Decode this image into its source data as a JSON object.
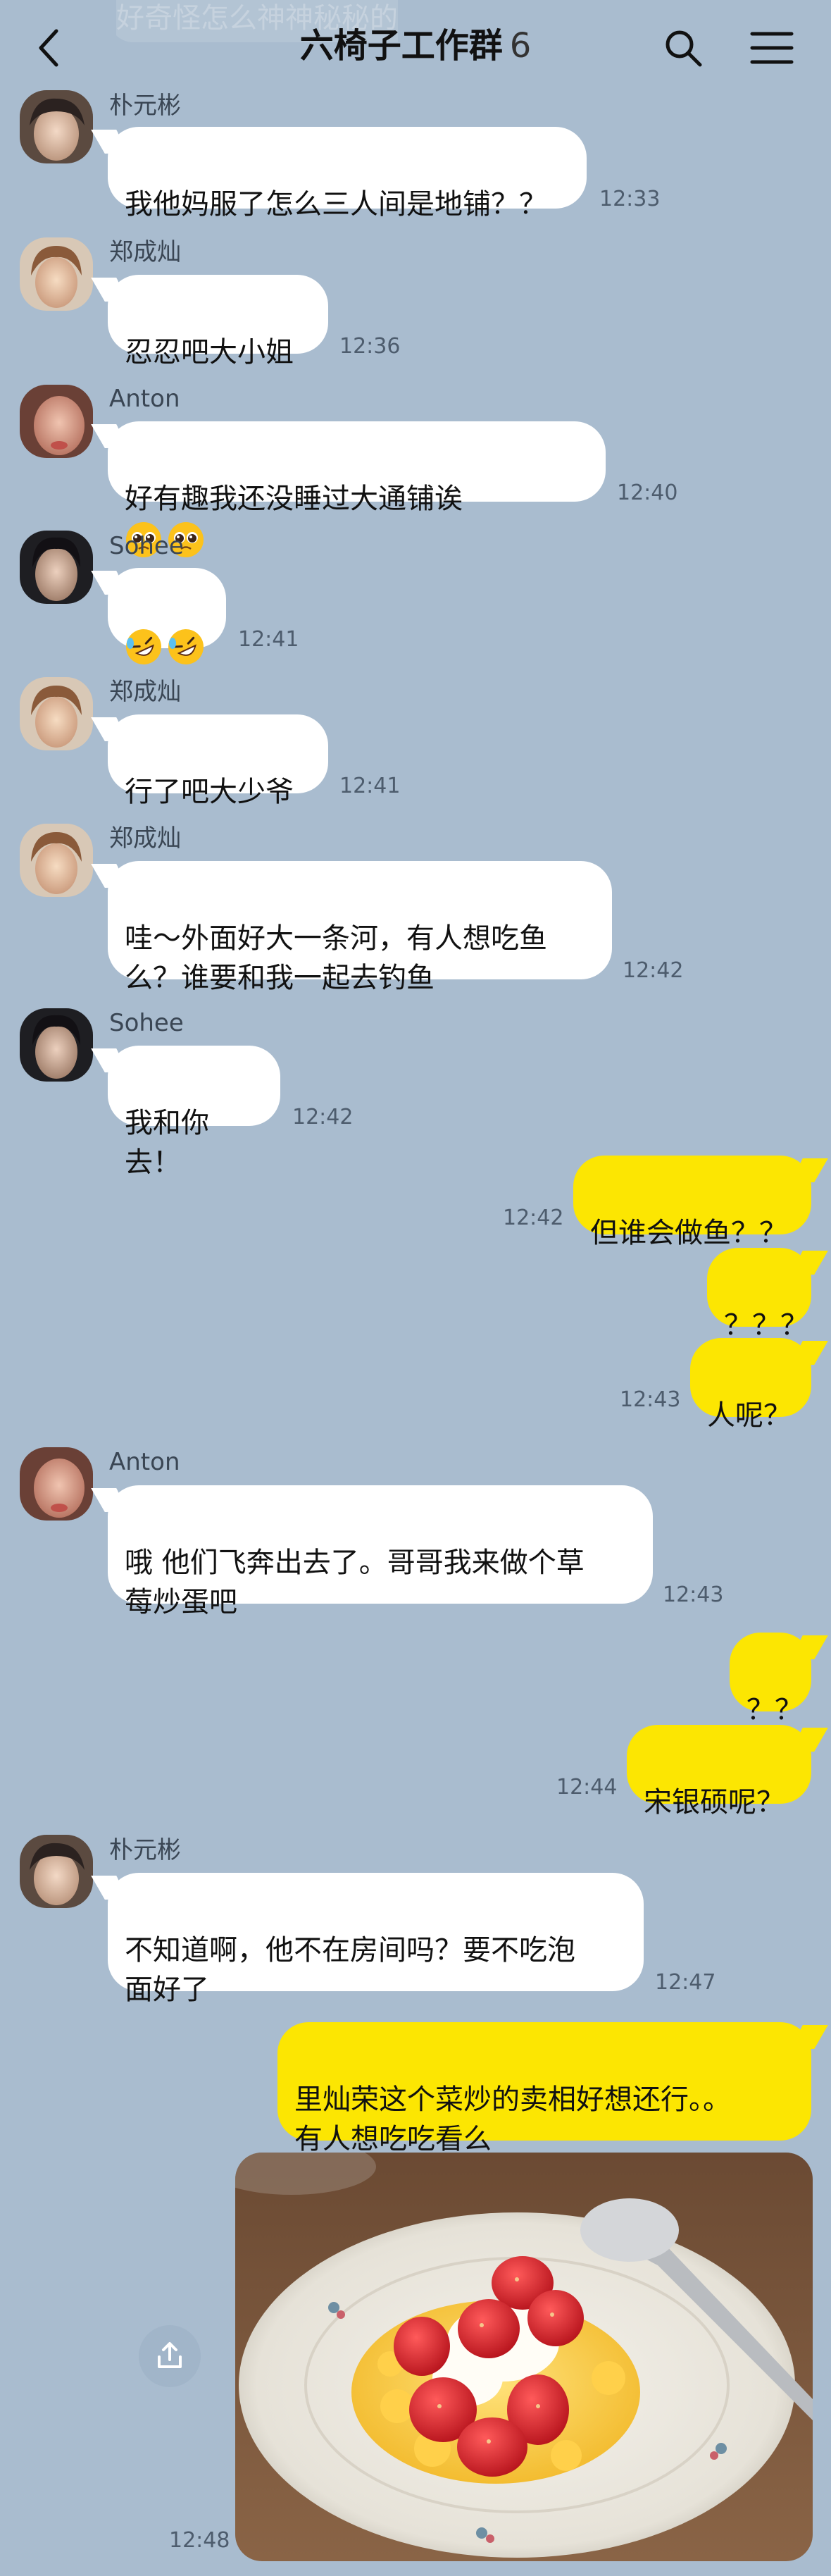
{
  "header": {
    "title": "六椅子工作群",
    "member_count": "6",
    "ghost_preview": "好奇怪怎么神神秘秘的"
  },
  "messages": [
    {
      "sender": "朴元彬",
      "text": "我他妈服了怎么三人间是地铺？？",
      "time": "12:33"
    },
    {
      "sender": "郑成灿",
      "text": "忍忍吧大小姐",
      "time": "12:36"
    },
    {
      "sender": "Anton",
      "text": "好有趣我还没睡过大通铺诶",
      "emojis": [
        "pleading-face",
        "pleading-face"
      ],
      "time": "12:40"
    },
    {
      "sender": "Sohee",
      "emojis": [
        "rolling-on-floor-laughing",
        "rolling-on-floor-laughing"
      ],
      "time": "12:41"
    },
    {
      "sender": "郑成灿",
      "text": "行了吧大少爷",
      "time": "12:41"
    },
    {
      "sender": "郑成灿",
      "text": "哇～外面好大一条河，有人想吃鱼\n么？谁要和我一起去钓鱼",
      "time": "12:42"
    },
    {
      "sender": "Sohee",
      "text": "我和你去！",
      "time": "12:42"
    },
    {
      "text": "但谁会做鱼？？",
      "time": "12:42"
    },
    {
      "text": "？？？"
    },
    {
      "text": "人呢？",
      "time": "12:43"
    },
    {
      "sender": "Anton",
      "text": "哦 他们飞奔出去了。哥哥我来做个草\n莓炒蛋吧",
      "time": "12:43"
    },
    {
      "text": "？？"
    },
    {
      "text": "宋银硕呢？",
      "time": "12:44"
    },
    {
      "sender": "朴元彬",
      "text": "不知道啊，他不在房间吗？要不吃泡\n面好了",
      "time": "12:47"
    },
    {
      "text": "里灿荣这个菜炒的卖相好想还行。。\n有人想吃吃看么"
    },
    {
      "time": "12:48"
    }
  ],
  "colors": {
    "background": "#a9bccf",
    "incoming_bubble": "#ffffff",
    "outgoing_bubble": "#fce602"
  }
}
